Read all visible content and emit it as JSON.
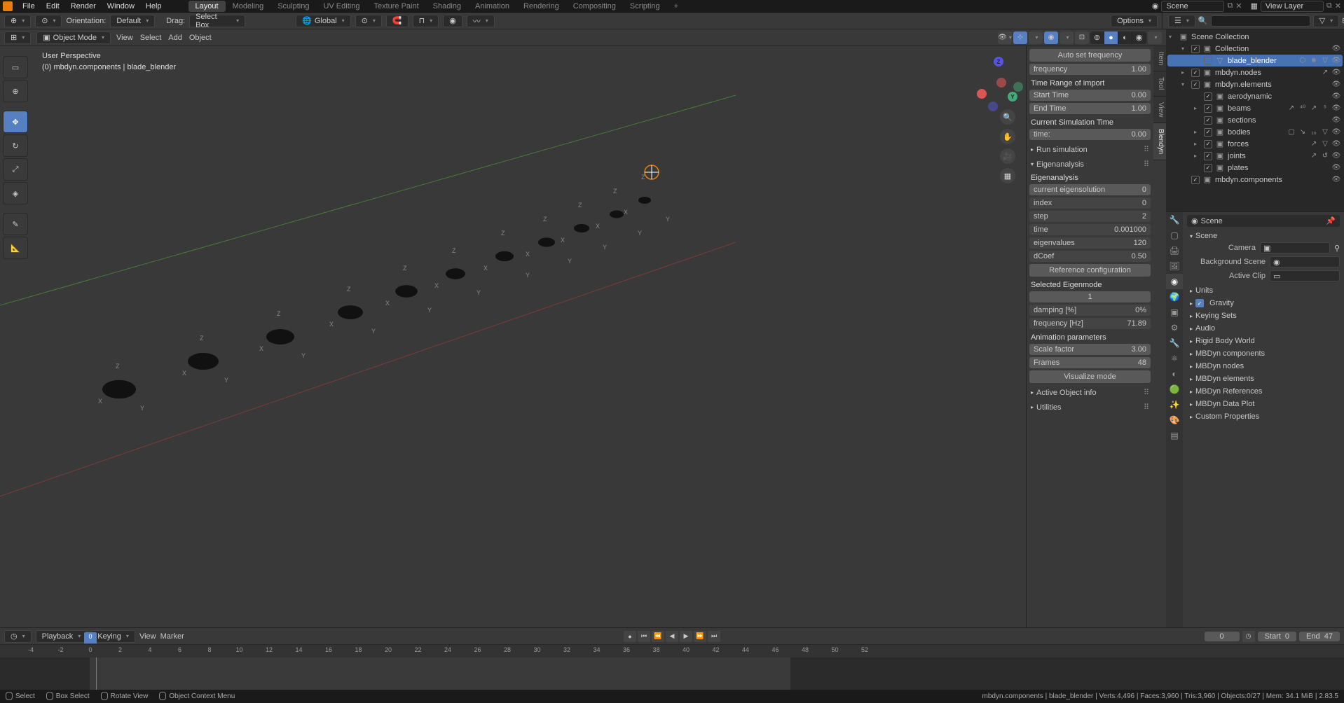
{
  "menu": {
    "items": [
      "File",
      "Edit",
      "Render",
      "Window",
      "Help"
    ]
  },
  "workspaces": [
    "Layout",
    "Modeling",
    "Sculpting",
    "UV Editing",
    "Texture Paint",
    "Shading",
    "Animation",
    "Rendering",
    "Compositing",
    "Scripting"
  ],
  "scene": {
    "name": "Scene",
    "viewlayer": "View Layer"
  },
  "second_bar": {
    "orientation_label": "Orientation:",
    "orientation": "Default",
    "drag_label": "Drag:",
    "drag": "Select Box",
    "global": "Global",
    "options": "Options"
  },
  "viewport_header": {
    "mode": "Object Mode",
    "menus": [
      "View",
      "Select",
      "Add",
      "Object"
    ]
  },
  "viewport": {
    "title": "User Perspective",
    "subtitle": "(0) mbdyn.components | blade_blender"
  },
  "vtabs": [
    "Item",
    "Tool",
    "View",
    "Blendyn"
  ],
  "npanel": {
    "autoset": "Auto set frequency",
    "freq_label": "frequency",
    "freq_val": "1.00",
    "time_range": "Time Range of import",
    "start_label": "Start Time",
    "start_val": "0.00",
    "end_label": "End Time",
    "end_val": "1.00",
    "curr_time": "Current Simulation Time",
    "time_label": "time:",
    "time_val": "0.00",
    "run_sim": "Run simulation",
    "eigen_hdr": "Eigenanalysis",
    "eigen": "Eigenanalysis",
    "curr_eig_label": "current eigensolution",
    "curr_eig_val": "0",
    "index_label": "index",
    "index_val": "0",
    "step_label": "step",
    "step_val": "2",
    "etime_label": "time",
    "etime_val": "0.001000",
    "eigvals_label": "eigenvalues",
    "eigvals_val": "120",
    "dcoef_label": "dCoef",
    "dcoef_val": "0.50",
    "refconf": "Reference configuration",
    "sel_eig": "Selected Eigenmode",
    "sel_eig_val": "1",
    "damping_label": "damping [%]",
    "damping_val": "0%",
    "freqhz_label": "frequency [Hz]",
    "freqhz_val": "71.89",
    "anim_params": "Animation parameters",
    "scale_label": "Scale factor",
    "scale_val": "3.00",
    "frames_label": "Frames",
    "frames_val": "48",
    "vis_mode": "Visualize mode",
    "active_obj": "Active Object info",
    "utilities": "Utilities"
  },
  "outliner": {
    "root": "Scene Collection",
    "items": [
      {
        "depth": 1,
        "toggle": "▾",
        "checked": true,
        "icon": "▣",
        "label": "Collection"
      },
      {
        "depth": 2,
        "toggle": "",
        "checked": false,
        "icon": "▽",
        "label": "blade_blender",
        "selected": true,
        "extra": "⬡ ⧻ ▽"
      },
      {
        "depth": 1,
        "toggle": "▸",
        "checked": true,
        "icon": "▣",
        "label": "mbdyn.nodes",
        "extra": "↗"
      },
      {
        "depth": 1,
        "toggle": "▾",
        "checked": true,
        "icon": "▣",
        "label": "mbdyn.elements"
      },
      {
        "depth": 2,
        "toggle": "",
        "checked": true,
        "icon": "▣",
        "label": "aerodynamic"
      },
      {
        "depth": 2,
        "toggle": "▸",
        "checked": true,
        "icon": "▣",
        "label": "beams",
        "extra": "↗ ⁴⁰ ↗ ⁵"
      },
      {
        "depth": 2,
        "toggle": "",
        "checked": true,
        "icon": "▣",
        "label": "sections"
      },
      {
        "depth": 2,
        "toggle": "▸",
        "checked": true,
        "icon": "▣",
        "label": "bodies",
        "extra": "▢ ↘ ₁₀ ▽"
      },
      {
        "depth": 2,
        "toggle": "▸",
        "checked": true,
        "icon": "▣",
        "label": "forces",
        "extra": "↗ ▽"
      },
      {
        "depth": 2,
        "toggle": "▸",
        "checked": true,
        "icon": "▣",
        "label": "joints",
        "extra": "↗ ↺"
      },
      {
        "depth": 2,
        "toggle": "",
        "checked": true,
        "icon": "▣",
        "label": "plates"
      },
      {
        "depth": 1,
        "toggle": "",
        "checked": true,
        "icon": "▣",
        "label": "mbdyn.components"
      }
    ]
  },
  "props": {
    "crumb": "Scene",
    "scene_hdr": "Scene",
    "camera": "Camera",
    "bg_scene": "Background Scene",
    "active_clip": "Active Clip",
    "sections": [
      "Units",
      "Gravity",
      "Keying Sets",
      "Audio",
      "Rigid Body World",
      "MBDyn components",
      "MBDyn nodes",
      "MBDyn elements",
      "MBDyn References",
      "MBDyn Data Plot",
      "Custom Properties"
    ]
  },
  "timeline": {
    "playback": "Playback",
    "keying": "Keying",
    "view": "View",
    "marker": "Marker",
    "current": "0",
    "start_label": "Start",
    "start": "0",
    "end_label": "End",
    "end": "47",
    "ticks": [
      "-4",
      "-2",
      "0",
      "2",
      "4",
      "6",
      "8",
      "10",
      "12",
      "14",
      "16",
      "18",
      "20",
      "22",
      "24",
      "26",
      "28",
      "30",
      "32",
      "34",
      "36",
      "38",
      "40",
      "42",
      "44",
      "46",
      "48",
      "50",
      "52"
    ]
  },
  "status": {
    "sel": "Select",
    "box": "Box Select",
    "rotate": "Rotate View",
    "ctx": "Object Context Menu",
    "stats": "mbdyn.components | blade_blender | Verts:4,496 | Faces:3,960 | Tris:3,960 | Objects:0/27 | Mem: 34.1 MiB | 2.83.5"
  }
}
